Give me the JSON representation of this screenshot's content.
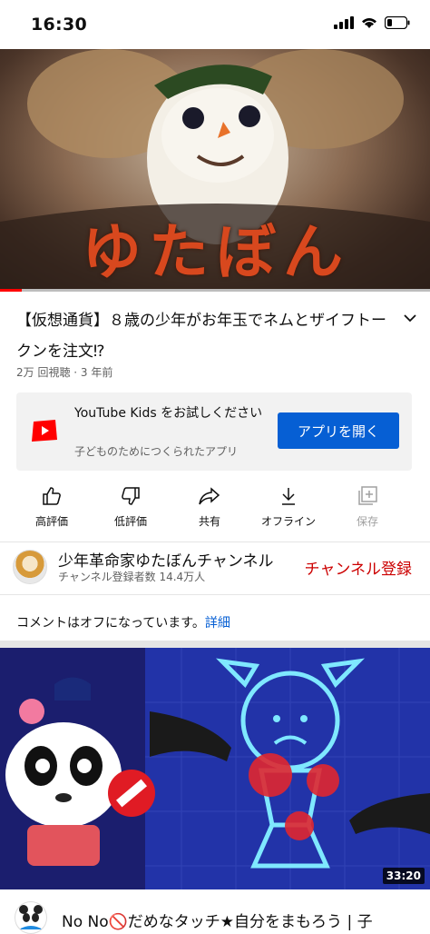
{
  "status_bar": {
    "time": "16:30"
  },
  "video": {
    "overlay_text": "ゆたぼん",
    "progress_fraction": 0.05
  },
  "details": {
    "title": "【仮想通貨】８歳の少年がお年玉でネムとザイフトークンを注文⁉",
    "meta": "2万 回視聴 · 3 年前"
  },
  "kids_promo": {
    "title": "YouTube Kids をお試しください",
    "subtitle": "子どものためにつくられたアプリ",
    "button": "アプリを開く"
  },
  "actions": [
    {
      "label": "高評価",
      "icon": "thumb-up-icon"
    },
    {
      "label": "低評価",
      "icon": "thumb-down-icon"
    },
    {
      "label": "共有",
      "icon": "share-icon"
    },
    {
      "label": "オフライン",
      "icon": "download-icon"
    },
    {
      "label": "保存",
      "icon": "add-to-playlist-icon"
    }
  ],
  "channel": {
    "name": "少年革命家ゆたぼんチャンネル",
    "subscribers": "チャンネル登録者数 14.4万人",
    "subscribe_label": "チャンネル登録"
  },
  "comments": {
    "text": "コメントはオフになっています。",
    "link": "詳細"
  },
  "next_video": {
    "duration": "33:20",
    "title": "No No🚫だめなタッチ★自分をまもろう | 子"
  },
  "colors": {
    "accent": "#065fd4",
    "red": "#ff0000",
    "subscribe": "#cc0000"
  }
}
